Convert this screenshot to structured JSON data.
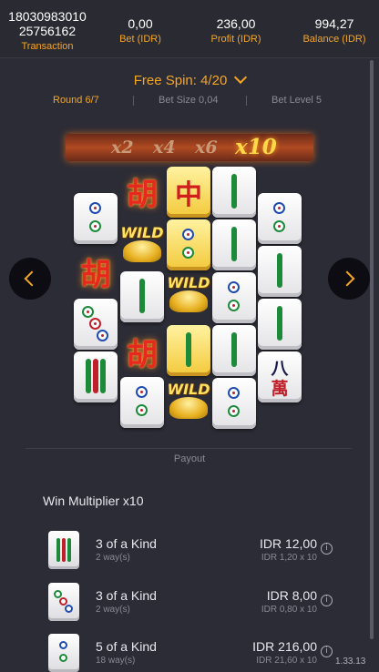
{
  "header": {
    "transaction_id_line1": "18030983010",
    "transaction_id_line2": "25756162",
    "transaction_label": "Transaction",
    "bet_value": "0,00",
    "bet_label": "Bet (IDR)",
    "profit_value": "236,00",
    "profit_label": "Profit (IDR)",
    "balance_value": "994,27",
    "balance_label": "Balance (IDR)"
  },
  "free_spin": {
    "title": "Free Spin: 4/20",
    "round": "Round 6/7",
    "bet_size": "Bet Size 0,04",
    "bet_level": "Bet Level 5"
  },
  "multipliers": [
    "x2",
    "x4",
    "x6",
    "x10"
  ],
  "active_multiplier": "x10",
  "symbols": {
    "wild_text": "WILD",
    "hu_char": "胡",
    "zhong_char": "中",
    "ba_char": "八",
    "wan_char": "萬"
  },
  "payout": {
    "label": "Payout",
    "win_multiplier": "Win Multiplier x10",
    "rows": [
      {
        "name": "3 of a Kind",
        "ways": "2 way(s)",
        "amount": "IDR 12,00",
        "calc": "IDR 1,20 x 10",
        "icon": "bamboo-tile-icon"
      },
      {
        "name": "3 of a Kind",
        "ways": "2 way(s)",
        "amount": "IDR 8,00",
        "calc": "IDR 0,80 x 10",
        "icon": "three-dots-tile-icon"
      },
      {
        "name": "5 of a Kind",
        "ways": "18 way(s)",
        "amount": "IDR 216,00",
        "calc": "IDR 21,60 x 10",
        "icon": "two-dots-tile-icon"
      }
    ],
    "info_glyph": "i"
  },
  "version": "1.33.13",
  "colors": {
    "accent": "#f5a623",
    "background": "#2c2c36",
    "header_bg": "#2a2a33"
  }
}
